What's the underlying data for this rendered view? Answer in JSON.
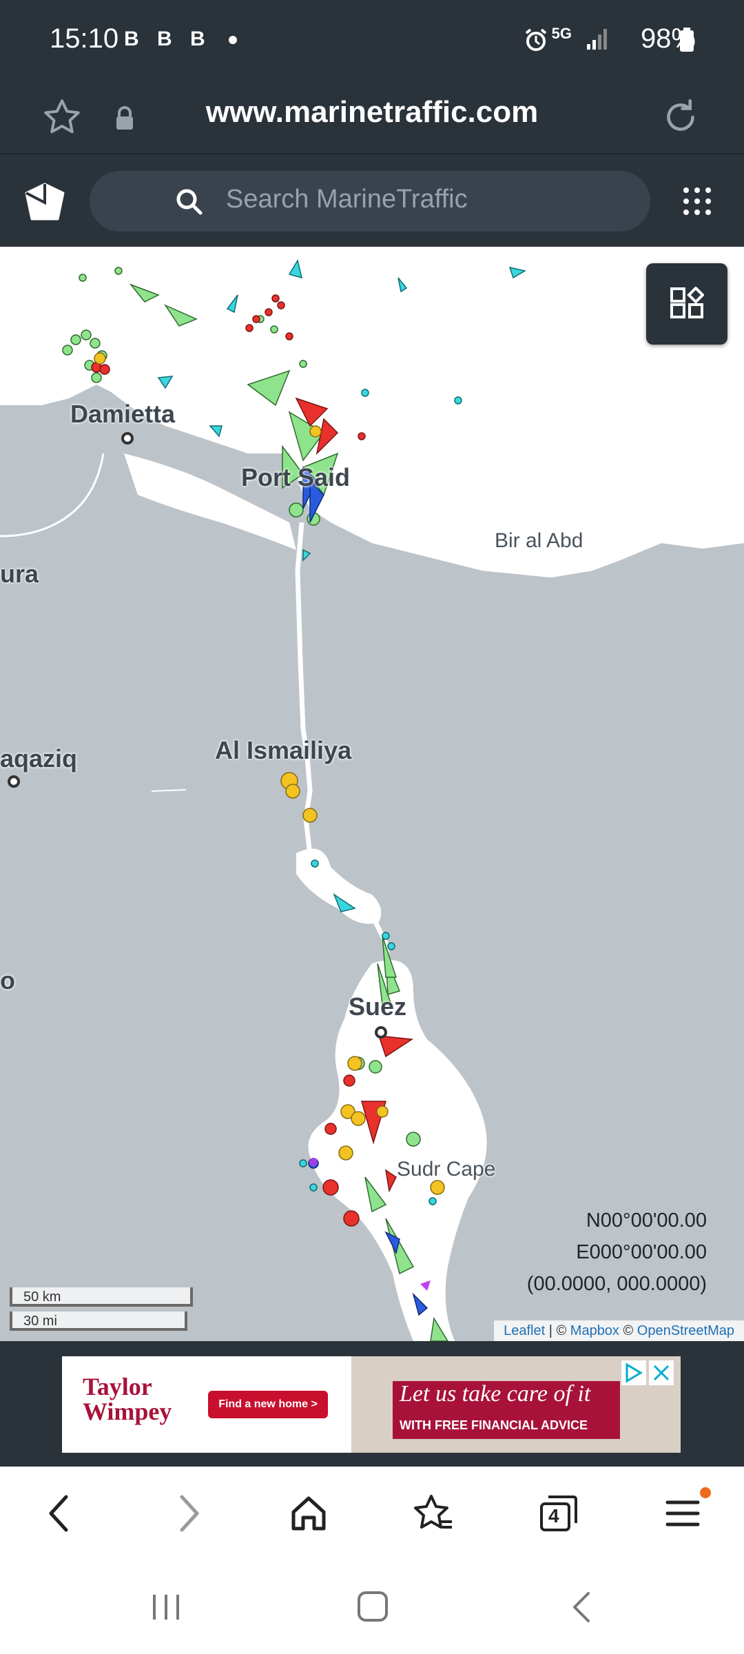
{
  "status_bar": {
    "time": "15:10",
    "b_badge": "B",
    "network": "5G",
    "battery": "98%"
  },
  "browser": {
    "url": "www.marinetraffic.com",
    "icons": [
      "star-icon",
      "lock-icon",
      "reload-icon"
    ]
  },
  "marinetraffic": {
    "search_placeholder": "Search MarineTraffic",
    "icons": [
      "marinetraffic-logo",
      "search-icon",
      "apps-grid-icon",
      "layers-icon"
    ]
  },
  "map": {
    "places": {
      "damietta": "Damietta",
      "port_said": "Port Said",
      "bir_al_abd": "Bir al Abd",
      "mansoura": "ura",
      "al_ismailiya": "Al Ismailiya",
      "zagazig": "aqaziq",
      "cairo": "o",
      "suez": "Suez",
      "sudr_cape": "Sudr Cape"
    },
    "coords": {
      "lat": "N00°00'00.00",
      "lon": "E000°00'00.00",
      "decimal": "(00.0000, 000.0000)"
    },
    "scale": {
      "metric": "50 km",
      "imperial": "30 mi"
    },
    "attribution": {
      "leaflet": "Leaflet",
      "sep1": " | © ",
      "mapbox": "Mapbox",
      "sep2": " © ",
      "osm": "OpenStreetMap"
    },
    "colors": {
      "water": "#bcc3c9",
      "land": "#ffffff",
      "cargo": "#8ee38c",
      "tanker": "#e8312c",
      "passenger": "#2a5bde",
      "tug": "#38d7e0",
      "anchor": "#f2c321"
    }
  },
  "ad": {
    "brand_line1": "Taylor",
    "brand_line2": "Wimpey",
    "button": "Find a new home >",
    "headline": "Let us take care of it",
    "subline": "WITH FREE FINANCIAL ADVICE"
  },
  "browser_nav": {
    "tabs_count": "4",
    "icons": [
      "back-icon",
      "forward-icon",
      "home-icon",
      "bookmarks-icon",
      "tabs-icon",
      "menu-icon"
    ]
  },
  "system_nav": {
    "icons": [
      "recents-icon",
      "home-button-icon",
      "back-button-icon"
    ]
  }
}
